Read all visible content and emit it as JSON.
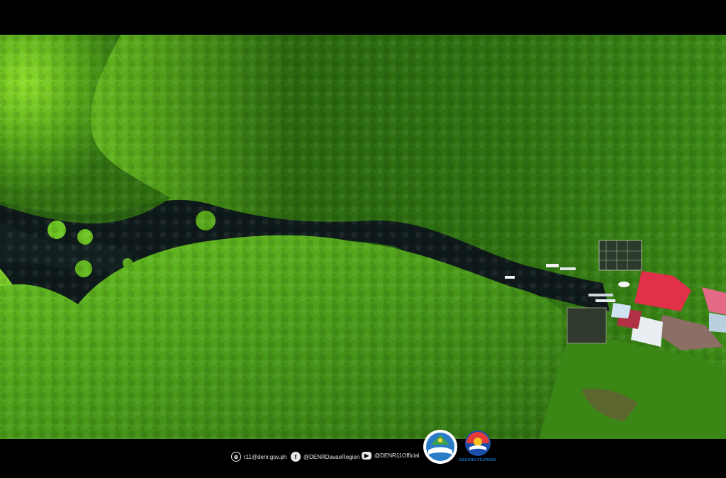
{
  "footer": {
    "email": "r11@denr.gov.ph",
    "facebook": "@DENRDavaoRegion",
    "youtube": "@DENR11Official",
    "logo_caption": "BAGONG PILIPINAS"
  },
  "icons": {
    "web": "globe-icon",
    "facebook": "facebook-icon",
    "youtube": "youtube-icon"
  },
  "colors": {
    "canopy_light": "#7ed321",
    "canopy_dark": "#1f5e0c",
    "water": "#0f1a1a",
    "roof_red": "#e0304a",
    "footer_bg": "#000000"
  }
}
